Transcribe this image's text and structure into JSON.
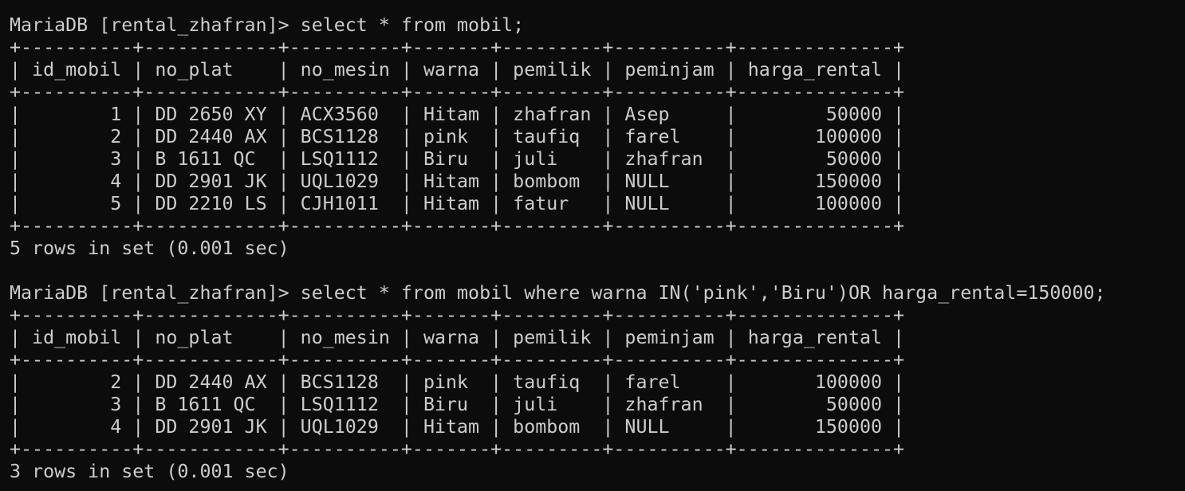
{
  "terminal": {
    "lines": [
      "MariaDB [rental_zhafran]> select * from mobil;",
      "+----------+------------+----------+-------+---------+----------+--------------+",
      "| id_mobil | no_plat    | no_mesin | warna | pemilik | peminjam | harga_rental |",
      "+----------+------------+----------+-------+---------+----------+--------------+",
      "|        1 | DD 2650 XY | ACX3560  | Hitam | zhafran | Asep     |        50000 |",
      "|        2 | DD 2440 AX | BCS1128  | pink  | taufiq  | farel    |       100000 |",
      "|        3 | B 1611 QC  | LSQ1112  | Biru  | juli    | zhafran  |        50000 |",
      "|        4 | DD 2901 JK | UQL1029  | Hitam | bombom  | NULL     |       150000 |",
      "|        5 | DD 2210 LS | CJH1011  | Hitam | fatur   | NULL     |       100000 |",
      "+----------+------------+----------+-------+---------+----------+--------------+",
      "5 rows in set (0.001 sec)",
      "",
      "MariaDB [rental_zhafran]> select * from mobil where warna IN('pink','Biru')OR harga_rental=150000;",
      "+----------+------------+----------+-------+---------+----------+--------------+",
      "| id_mobil | no_plat    | no_mesin | warna | pemilik | peminjam | harga_rental |",
      "+----------+------------+----------+-------+---------+----------+--------------+",
      "|        2 | DD 2440 AX | BCS1128  | pink  | taufiq  | farel    |       100000 |",
      "|        3 | B 1611 QC  | LSQ1112  | Biru  | juli    | zhafran  |        50000 |",
      "|        4 | DD 2901 JK | UQL1029  | Hitam | bombom  | NULL     |       150000 |",
      "+----------+------------+----------+-------+---------+----------+--------------+",
      "3 rows in set (0.001 sec)"
    ]
  }
}
